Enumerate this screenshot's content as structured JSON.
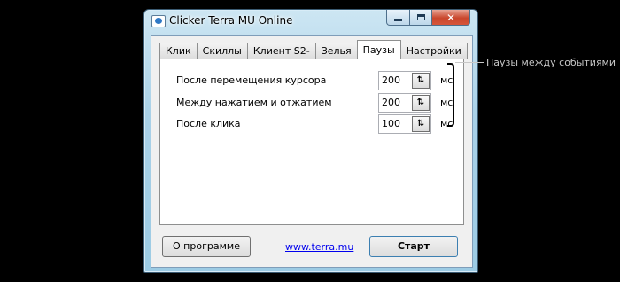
{
  "window": {
    "title": "Clicker Terra MU Online"
  },
  "caption": {
    "close_glyph": "✕"
  },
  "tabs": [
    {
      "label": "Клик"
    },
    {
      "label": "Скиллы"
    },
    {
      "label": "Клиент S2-"
    },
    {
      "label": "Зелья"
    },
    {
      "label": "Паузы"
    },
    {
      "label": "Настройки"
    }
  ],
  "pauses": [
    {
      "label": "После перемещения курсора",
      "value": "200",
      "unit": "мс"
    },
    {
      "label": "Между нажатием и отжатием",
      "value": "200",
      "unit": "мс"
    },
    {
      "label": "После клика",
      "value": "100",
      "unit": "мс"
    }
  ],
  "spin_glyph": "⇅",
  "footer": {
    "about_label": "О программе",
    "link_text": "www.terra.mu",
    "start_label": "Старт"
  },
  "annotation": {
    "text": "Паузы между событиями"
  },
  "colors": {
    "link": "#0000ee",
    "accent": "#a9d1e8"
  }
}
